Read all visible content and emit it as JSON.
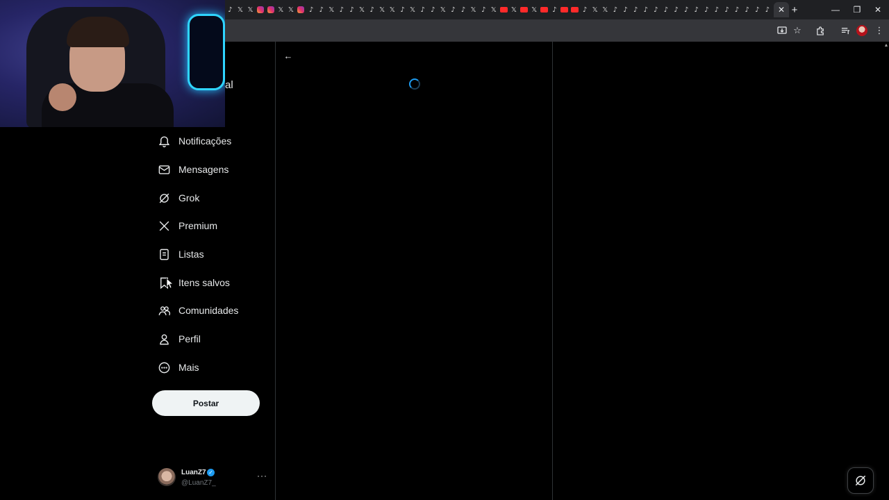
{
  "browser": {
    "tab_favicons": [
      "tiktok-icon",
      "x-icon",
      "x-icon",
      "instagram-icon",
      "instagram-icon",
      "x-icon",
      "x-icon",
      "instagram-icon",
      "tiktok-icon",
      "tiktok-icon",
      "x-icon",
      "tiktok-icon",
      "tiktok-icon",
      "x-icon",
      "tiktok-icon",
      "x-icon",
      "x-icon",
      "tiktok-icon",
      "x-icon",
      "tiktok-icon",
      "tiktok-icon",
      "x-icon",
      "tiktok-icon",
      "tiktok-icon",
      "x-icon",
      "tiktok-icon",
      "x-icon",
      "youtube-icon",
      "x-icon",
      "youtube-icon",
      "x-icon",
      "youtube-icon",
      "tiktok-icon",
      "youtube-icon",
      "youtube-icon",
      "tiktok-icon",
      "x-icon",
      "x-icon",
      "tiktok-icon",
      "tiktok-icon",
      "tiktok-icon",
      "tiktok-icon",
      "tiktok-icon",
      "tiktok-icon",
      "tiktok-icon",
      "tiktok-icon",
      "tiktok-icon",
      "tiktok-icon",
      "tiktok-icon",
      "tiktok-icon",
      "tiktok-icon",
      "tiktok-icon",
      "tiktok-icon",
      "tiktok-icon"
    ],
    "active_tab_close": "✕",
    "new_tab": "+",
    "window_controls": {
      "minimize": "—",
      "restore": "❐",
      "close": "✕"
    }
  },
  "webcam": {
    "partial_label": "al"
  },
  "nav": {
    "items": [
      {
        "name": "notifications",
        "label": "Notificações",
        "icon": "bell-icon"
      },
      {
        "name": "messages",
        "label": "Mensagens",
        "icon": "mail-icon"
      },
      {
        "name": "grok",
        "label": "Grok",
        "icon": "grok-icon"
      },
      {
        "name": "premium",
        "label": "Premium",
        "icon": "x-logo-icon"
      },
      {
        "name": "lists",
        "label": "Listas",
        "icon": "list-icon"
      },
      {
        "name": "bookmarks",
        "label": "Itens salvos",
        "icon": "bookmark-icon"
      },
      {
        "name": "communities",
        "label": "Comunidades",
        "icon": "people-icon"
      },
      {
        "name": "profile",
        "label": "Perfil",
        "icon": "person-icon"
      },
      {
        "name": "more",
        "label": "Mais",
        "icon": "more-circle-icon"
      }
    ],
    "post_button": "Postar"
  },
  "account": {
    "name": "LuanZ7",
    "handle": "@LuanZ7_",
    "more": "···"
  },
  "main": {
    "back": "←"
  },
  "colors": {
    "accent": "#1d9bf0",
    "background": "#000000",
    "text": "#e7e9ea",
    "muted": "#71767b"
  }
}
